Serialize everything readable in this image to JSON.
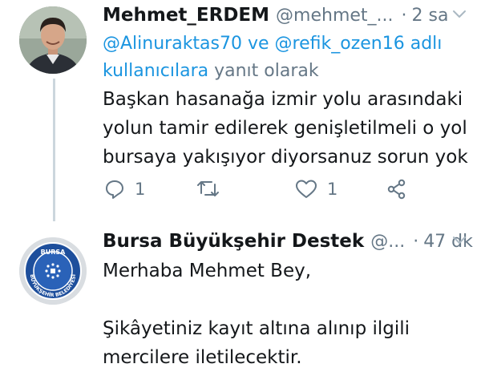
{
  "tweets": [
    {
      "author": "Mehmet_ERDEM",
      "handle": "@mehmet_...",
      "dot": "·",
      "time": "2 sa",
      "reply": {
        "mention1": "@Alinuraktas70",
        "conj": " ve ",
        "mention2": "@refik_ozen16",
        "suffix1": " adlı",
        "mention3": "kullanıcılara",
        "suffix2": " yanıt olarak"
      },
      "text": "Başkan hasanağa izmir yolu arasındaki\nyolun tamir edilerek genişletilmeli o yol\nbursaya yakışıyor diyorsanuz sorun yok",
      "actions": {
        "reply_count": "1",
        "retweet_count": "",
        "like_count": "1"
      }
    },
    {
      "author": "Bursa Büyükşehir Destek",
      "handle": "@...",
      "dot": "·",
      "time": "47 dk",
      "text": "Merhaba Mehmet Bey,\n\nŞikâyetiniz kayıt altına alınıp ilgili\nmercilere iletilecektir.",
      "logo": {
        "top_text": "BURSA",
        "ring_text": "BÜYÜKŞEHİR BELEDİYESİ"
      }
    }
  ],
  "icons": {
    "reply": "reply-icon",
    "retweet": "retweet-icon",
    "like": "heart-icon",
    "share": "share-icon",
    "menu": "chevron-down-icon"
  },
  "colors": {
    "link": "#1b95e0",
    "muted": "#657786",
    "text": "#14171a",
    "thread_line": "#ccd6dd",
    "logo_blue": "#1e4f9c"
  }
}
